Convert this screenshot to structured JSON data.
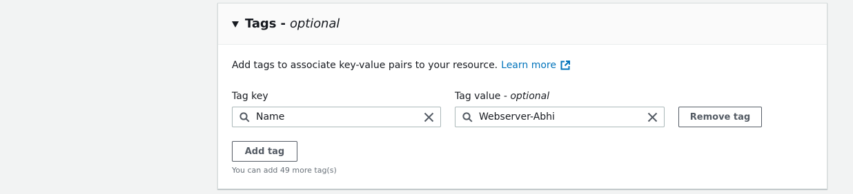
{
  "tags_panel": {
    "title": "Tags -",
    "title_optional": "optional",
    "description": "Add tags to associate key-value pairs to your resource.",
    "learn_more": "Learn more",
    "tag_key_label": "Tag key",
    "tag_value_label": "Tag value -",
    "tag_value_optional": "optional",
    "rows": [
      {
        "key": "Name",
        "value": "Webserver-Abhi",
        "remove_label": "Remove tag"
      }
    ],
    "add_tag_label": "Add tag",
    "hint": "You can add 49 more tag(s)"
  },
  "colors": {
    "link": "#0073bb",
    "button_border": "#545b64",
    "input_border": "#aab7b8",
    "hint": "#687078"
  },
  "icons": [
    "caret-down-icon",
    "external-link-icon",
    "search-icon",
    "clear-icon"
  ]
}
